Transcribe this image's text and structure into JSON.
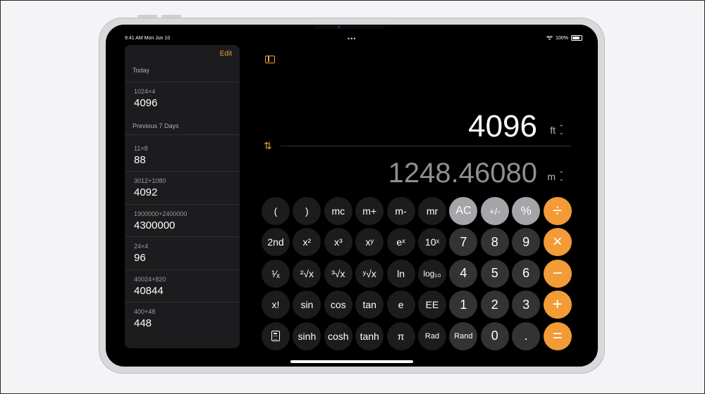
{
  "status": {
    "time": "9:41 AM Mon Jun 10",
    "battery": "100%",
    "wifi_icon": "wifi-icon"
  },
  "sidebar": {
    "edit_label": "Edit",
    "sections": [
      {
        "title": "Today",
        "items": [
          {
            "expr": "1024×4",
            "result": "4096"
          }
        ]
      },
      {
        "title": "Previous 7 Days",
        "items": [
          {
            "expr": "11×8",
            "result": "88"
          },
          {
            "expr": "3012+1080",
            "result": "4092"
          },
          {
            "expr": "1900000+2400000",
            "result": "4300000"
          },
          {
            "expr": "24×4",
            "result": "96"
          },
          {
            "expr": "40024+820",
            "result": "40844"
          },
          {
            "expr": "400+48",
            "result": "448"
          }
        ]
      }
    ]
  },
  "display": {
    "primary_value": "4096",
    "primary_unit": "ft",
    "secondary_value": "1248.46080",
    "secondary_unit": "m"
  },
  "keys": [
    [
      "(",
      ")",
      "mc",
      "m+",
      "m-",
      "mr",
      "AC",
      "+/-",
      "%",
      "÷"
    ],
    [
      "2nd",
      "x²",
      "x³",
      "xʸ",
      "eˣ",
      "10ˣ",
      "7",
      "8",
      "9",
      "×"
    ],
    [
      "¹⁄ₓ",
      "²√x",
      "³√x",
      "ʸ√x",
      "ln",
      "log₁₀",
      "4",
      "5",
      "6",
      "−"
    ],
    [
      "x!",
      "sin",
      "cos",
      "tan",
      "e",
      "EE",
      "1",
      "2",
      "3",
      "+"
    ],
    [
      "",
      "sinh",
      "cosh",
      "tanh",
      "π",
      "Rad",
      "Rand",
      "0",
      ".",
      "="
    ]
  ],
  "colors": {
    "accent": "#f39b36",
    "number_key": "#333336",
    "function_key": "#1c1c1e",
    "light_key": "#a5a5a9"
  }
}
